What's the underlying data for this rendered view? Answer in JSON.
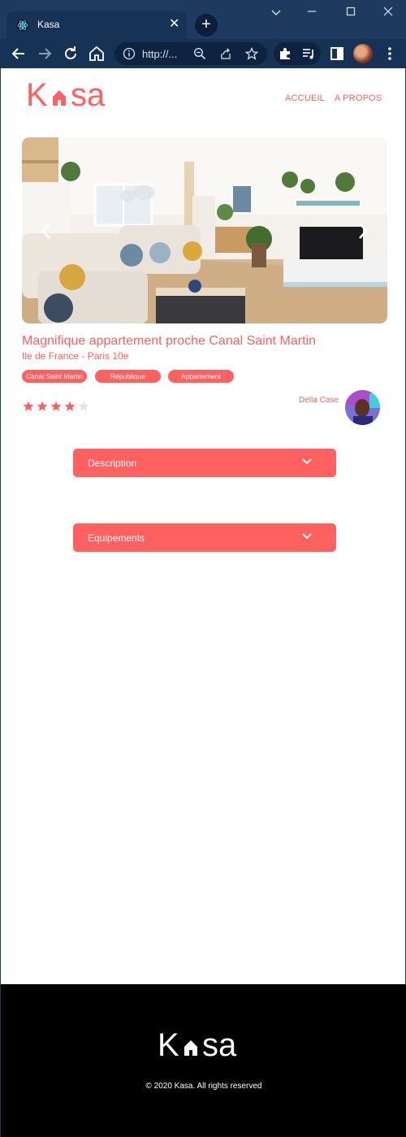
{
  "browser": {
    "tab_title": "Kasa",
    "address": "http://...",
    "colors": {
      "frame": "#1e3a5f",
      "toolbar": "#163356"
    }
  },
  "header": {
    "logo_text": "Kasa",
    "nav": [
      {
        "label": "ACCUEIL"
      },
      {
        "label": "A PROPOS"
      }
    ]
  },
  "listing": {
    "title": "Magnifique appartement proche Canal Saint Martin",
    "location": "Ile de France - Paris 10e",
    "tags": [
      "Canal Saint Martin",
      "République",
      "Appartement"
    ],
    "rating": 4,
    "rating_max": 5,
    "host": {
      "name": "Della Case"
    },
    "carousel": {
      "prev_icon": "chevron-left-icon",
      "next_icon": "chevron-right-icon"
    }
  },
  "collapses": [
    {
      "label": "Description",
      "icon": "chevron-down-icon"
    },
    {
      "label": "Equipements",
      "icon": "chevron-down-icon"
    }
  ],
  "footer": {
    "logo_text": "Kasa",
    "copyright": "© 2020 Kasa. All rights reserved"
  },
  "colors": {
    "accent": "#ff6060",
    "footer_bg": "#000000"
  }
}
